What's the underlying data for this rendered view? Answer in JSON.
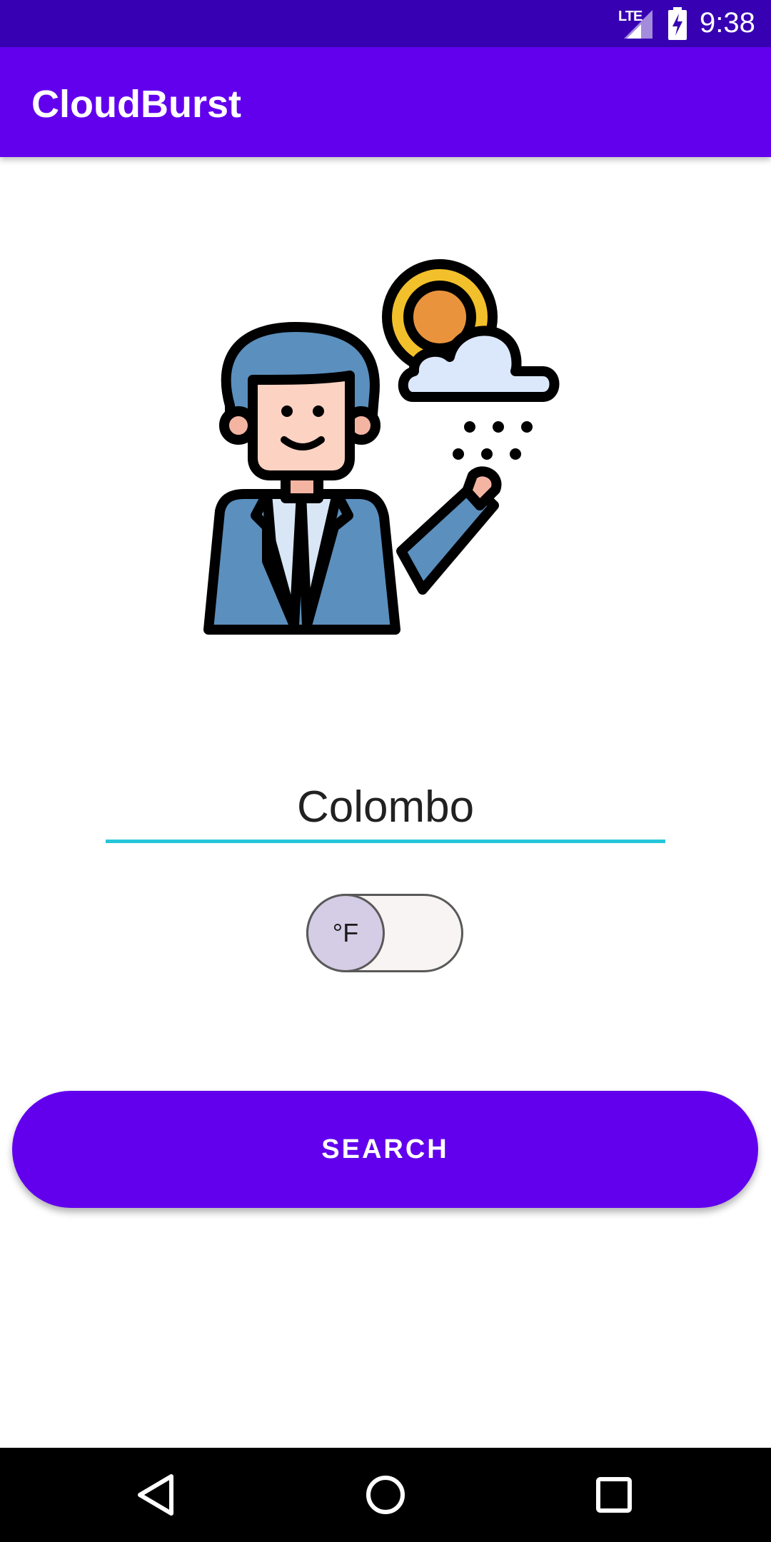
{
  "status_bar": {
    "network": "LTE",
    "time": "9:38",
    "icons": [
      "signal-icon",
      "battery-charging-icon"
    ]
  },
  "app_bar": {
    "title": "CloudBurst"
  },
  "illustration": {
    "icon": "weatherman-illustration",
    "colors": {
      "suit": "#5b8fbd",
      "sun": "#f2c02a",
      "cloud": "#dbe8fb"
    }
  },
  "search": {
    "city_value": "Colombo",
    "unit_toggle_label": "°F",
    "button_label": "SEARCH"
  },
  "nav_bar": {
    "icons": [
      "back-icon",
      "home-icon",
      "recents-icon"
    ]
  },
  "colors": {
    "status_bar": "#3700b3",
    "primary": "#6200ee",
    "input_underline": "#26c6da",
    "toggle_thumb": "#d5cce6"
  }
}
